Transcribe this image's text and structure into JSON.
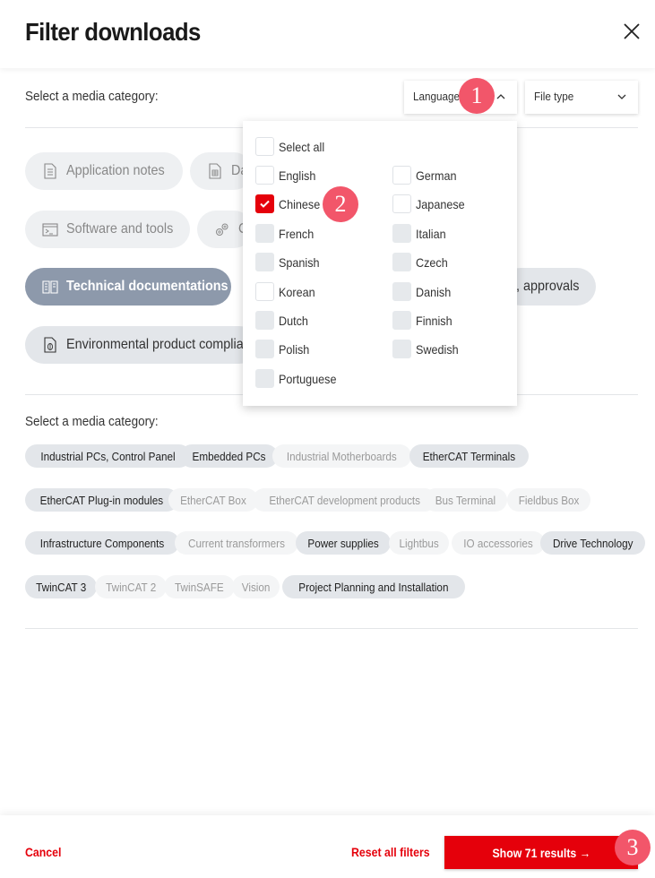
{
  "header": {
    "title": "Filter downloads",
    "close_icon": "close-icon"
  },
  "filters": {
    "media_label": "Select a media category:",
    "language_dropdown": {
      "label": "Language",
      "state": "open",
      "icon": "chevron-up-icon"
    },
    "filetype_dropdown": {
      "label": "File type",
      "state": "closed",
      "icon": "chevron-down-icon"
    }
  },
  "media_categories": [
    {
      "label": "Application notes",
      "icon": "document-icon",
      "state": "inactive"
    },
    {
      "label": "Da",
      "icon": "spreadsheet-document-icon",
      "state": "inactive"
    },
    {
      "label": "Software and tools",
      "icon": "terminal-window-icon",
      "state": "inactive"
    },
    {
      "label": "C",
      "icon": "gears-icon",
      "state": "inactive"
    },
    {
      "label": "Technical documentations",
      "icon": "open-book-icon",
      "state": "active"
    },
    {
      "label": ", approvals",
      "icon": "",
      "state": "available"
    },
    {
      "label": "Environmental product complia",
      "icon": "leaf-document-icon",
      "state": "available"
    }
  ],
  "language_menu": {
    "select_all": {
      "label": "Select all",
      "checked": false,
      "disabled": false
    },
    "options": [
      {
        "label": "English",
        "checked": false,
        "disabled": false
      },
      {
        "label": "German",
        "checked": false,
        "disabled": false
      },
      {
        "label": "Chinese",
        "checked": true,
        "disabled": false
      },
      {
        "label": "Japanese",
        "checked": false,
        "disabled": false
      },
      {
        "label": "French",
        "checked": false,
        "disabled": true
      },
      {
        "label": "Italian",
        "checked": false,
        "disabled": true
      },
      {
        "label": "Spanish",
        "checked": false,
        "disabled": true
      },
      {
        "label": "Czech",
        "checked": false,
        "disabled": true
      },
      {
        "label": "Korean",
        "checked": false,
        "disabled": false
      },
      {
        "label": "Danish",
        "checked": false,
        "disabled": true
      },
      {
        "label": "Dutch",
        "checked": false,
        "disabled": true
      },
      {
        "label": "Finnish",
        "checked": false,
        "disabled": true
      },
      {
        "label": "Polish",
        "checked": false,
        "disabled": true
      },
      {
        "label": "Swedish",
        "checked": false,
        "disabled": true
      },
      {
        "label": "Portuguese",
        "checked": false,
        "disabled": true
      }
    ]
  },
  "product_section": {
    "label": "Select a media category:",
    "tags": [
      {
        "label": "Industrial PCs, Control Panel",
        "available": true
      },
      {
        "label": "Embedded PCs",
        "available": true
      },
      {
        "label": "Industrial Motherboards",
        "available": false
      },
      {
        "label": "EtherCAT Terminals",
        "available": true
      },
      {
        "label": "EtherCAT Plug-in modules",
        "available": true
      },
      {
        "label": "EtherCAT Box",
        "available": false
      },
      {
        "label": "EtherCAT development products",
        "available": false
      },
      {
        "label": "Bus Terminal",
        "available": false
      },
      {
        "label": "Fieldbus Box",
        "available": false
      },
      {
        "label": "Infrastructure Components",
        "available": true
      },
      {
        "label": "Current transformers",
        "available": false
      },
      {
        "label": "Power supplies",
        "available": true
      },
      {
        "label": "Lightbus",
        "available": false
      },
      {
        "label": "IO accessories",
        "available": false
      },
      {
        "label": "Drive Technology",
        "available": true
      },
      {
        "label": "TwinCAT 3",
        "available": true
      },
      {
        "label": "TwinCAT 2",
        "available": false
      },
      {
        "label": "TwinSAFE",
        "available": false
      },
      {
        "label": "Vision",
        "available": false
      },
      {
        "label": "Project Planning and Installation",
        "available": true
      }
    ]
  },
  "footer": {
    "cancel": "Cancel",
    "reset": "Reset all filters",
    "show_results": "Show 71 results →",
    "result_count": 71
  },
  "annotations": [
    "1",
    "2",
    "3"
  ],
  "colors": {
    "accent": "#e5000b",
    "active_pill": "#8d99ab",
    "annotation": "#f2566a"
  }
}
